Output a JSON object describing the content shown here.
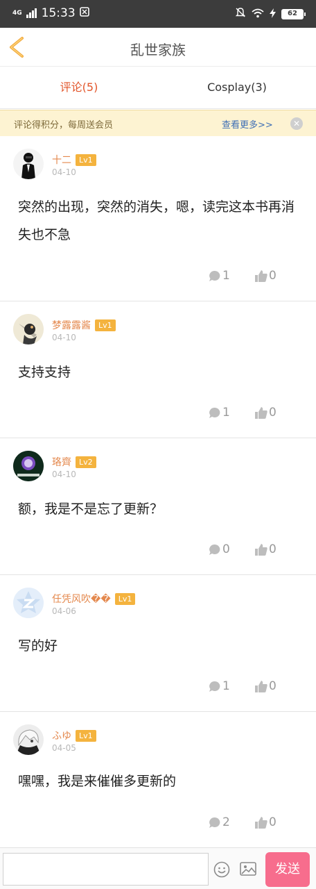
{
  "status_bar": {
    "network": "4G",
    "time": "15:33",
    "battery": "62"
  },
  "nav": {
    "title": "乱世家族"
  },
  "tabs": [
    {
      "label": "评论(5)",
      "active": true
    },
    {
      "label": "Cosplay(3)",
      "active": false
    }
  ],
  "notice": {
    "text": "评论得积分，每周送会员",
    "link": "查看更多>>"
  },
  "comments": [
    {
      "username": "十二",
      "level": "Lv1",
      "date": "04-10",
      "text": "突然的出现，突然的消失，嗯，读完这本书再消失也不急",
      "replies": "1",
      "likes": "0"
    },
    {
      "username": "梦露露酱",
      "level": "Lv1",
      "date": "04-10",
      "text": "支持支持",
      "replies": "1",
      "likes": "0"
    },
    {
      "username": "珞齊",
      "level": "Lv2",
      "date": "04-10",
      "text": "额，我是不是忘了更新？",
      "replies": "0",
      "likes": "0"
    },
    {
      "username": "任凭风吹��",
      "level": "Lv1",
      "date": "04-06",
      "text": "写的好",
      "replies": "1",
      "likes": "0"
    },
    {
      "username": "ふゆ",
      "level": "Lv1",
      "date": "04-05",
      "text": "嘿嘿，我是来催催多更新的",
      "replies": "2",
      "likes": "0"
    }
  ],
  "input_bar": {
    "placeholder": "",
    "send_label": "发送"
  },
  "colors": {
    "accent": "#e2552a",
    "username": "#e4884d",
    "level_badge": "#f4b33e",
    "send_button": "#f76d8d",
    "notice_bg": "#fdf3d2"
  }
}
